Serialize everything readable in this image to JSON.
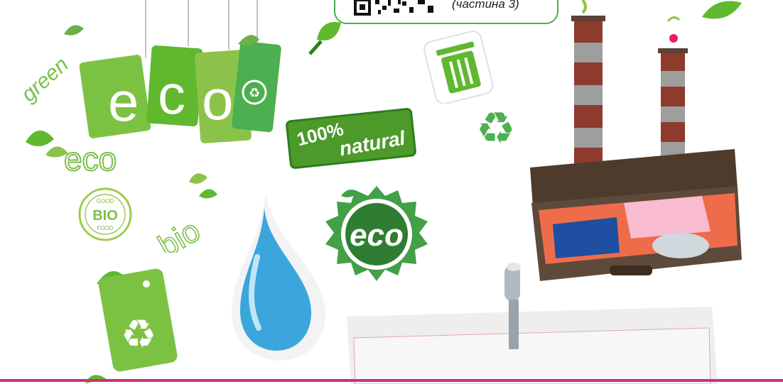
{
  "caption": {
    "text": "(частина 3)",
    "qr_label": "qr-code"
  },
  "tags": {
    "letters": [
      "e",
      "c",
      "o"
    ],
    "word_green": "green",
    "word_eco_script": "eco",
    "word_bio_script": "bio"
  },
  "stamp_natural": {
    "line1": "100%",
    "line2": "natural"
  },
  "seal_bio": {
    "top": "GOOD",
    "center": "BIO",
    "bottom": "FOOD"
  },
  "seal_eco": {
    "text": "eco"
  },
  "colors": {
    "green": "#5fb82e",
    "dark_green": "#2e7d1f",
    "light_green": "#9ccc52",
    "accent_pink": "#c8327a",
    "water_blue": "#3aa6dc"
  }
}
